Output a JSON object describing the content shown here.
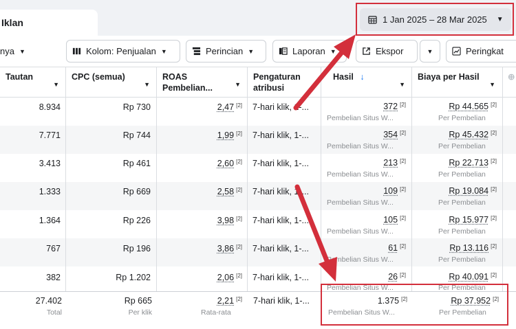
{
  "tab": {
    "label": "Iklan"
  },
  "date_range": {
    "label": "1 Jan 2025 – 28 Mar 2025"
  },
  "toolbar": {
    "partial_label": "nya",
    "columns_label": "Kolom: Penjualan",
    "breakdown_label": "Perincian",
    "reports_label": "Laporan",
    "export_label": "Ekspor",
    "rank_label": "Peringkat"
  },
  "headers": {
    "link": "Tautan",
    "cpc": "CPC (semua)",
    "roas_line1": "ROAS",
    "roas_line2": "Pembelian...",
    "attr_line1": "Pengaturan",
    "attr_line2": "atribusi",
    "result": "Hasil",
    "cost": "Biaya per Hasil"
  },
  "rows": [
    {
      "link": "8.934",
      "cpc": "Rp 730",
      "roas": "2,47",
      "attr": "7-hari klik, 1-...",
      "result": "372",
      "result_sub": "Pembelian Situs W...",
      "cost": "Rp 44.565",
      "cost_sub": "Per Pembelian"
    },
    {
      "link": "7.771",
      "cpc": "Rp 744",
      "roas": "1,99",
      "attr": "7-hari klik, 1-...",
      "result": "354",
      "result_sub": "Pembelian Situs W...",
      "cost": "Rp 45.432",
      "cost_sub": "Per Pembelian"
    },
    {
      "link": "3.413",
      "cpc": "Rp 461",
      "roas": "2,60",
      "attr": "7-hari klik, 1-...",
      "result": "213",
      "result_sub": "Pembelian Situs W...",
      "cost": "Rp 22.713",
      "cost_sub": "Per Pembelian"
    },
    {
      "link": "1.333",
      "cpc": "Rp 669",
      "roas": "2,58",
      "attr": "7-hari klik, 1-...",
      "result": "109",
      "result_sub": "Pembelian Situs W...",
      "cost": "Rp 19.084",
      "cost_sub": "Per Pembelian"
    },
    {
      "link": "1.364",
      "cpc": "Rp 226",
      "roas": "3,98",
      "attr": "7-hari klik, 1-...",
      "result": "105",
      "result_sub": "Pembelian Situs W...",
      "cost": "Rp 15.977",
      "cost_sub": "Per Pembelian"
    },
    {
      "link": "767",
      "cpc": "Rp 196",
      "roas": "3,86",
      "attr": "7-hari klik, 1-...",
      "result": "61",
      "result_sub": "Pembelian Situs W...",
      "cost": "Rp 13.116",
      "cost_sub": "Per Pembelian"
    },
    {
      "link": "382",
      "cpc": "Rp 1.202",
      "roas": "2,06",
      "attr": "7-hari klik, 1-...",
      "result": "26",
      "result_sub": "Pembelian Situs W...",
      "cost": "Rp 40.091",
      "cost_sub": "Per Pembelian"
    }
  ],
  "totals": {
    "link": "27.402",
    "link_sub": "Total",
    "cpc": "Rp 665",
    "cpc_sub": "Per klik",
    "roas": "2,21",
    "roas_sub": "Rata-rata",
    "attr": "7-hari klik, 1-...",
    "result": "1.375",
    "result_sub": "Pembelian Situs W...",
    "cost": "Rp 37.952",
    "cost_sub": "Per Pembelian"
  },
  "footnote_marker": "[2]",
  "colors": {
    "annotation_red": "#d32f3b",
    "sort_blue": "#1877f2"
  }
}
